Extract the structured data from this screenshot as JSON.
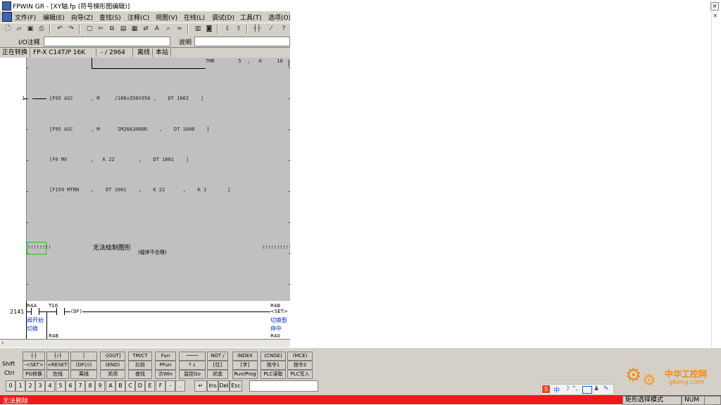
{
  "title_bar": {
    "text": "FPWIN GR - [XY轴.fp (符号梯形图编辑)]"
  },
  "menu": [
    "文件(F)",
    "编辑(E)",
    "向导(Z)",
    "查找(S)",
    "注释(C)",
    "视图(V)",
    "在线(L)",
    "调试(D)",
    "工具(T)",
    "选项(O)"
  ],
  "comment_bar": {
    "io_label": "I/O注释",
    "desc_label": "说明",
    "io_value": "",
    "desc_value": ""
  },
  "status_top": {
    "mode": "正在转换",
    "plc": "FP-X C14T/P 16K",
    "steps": "- / 2964",
    "online": "离线",
    "station": "本站"
  },
  "ladder": {
    "tmr_text": "TMR        5  ,   K     10",
    "row1_num": "1",
    "row1": "[F95 ASC      , M     /180v350V350 ,    DT 1002    ]",
    "row2": "[F95 ASC      , M      IM20A3000R    ,    DT 1008    ]",
    "row3": "[F0 MV        ,   K 22        ,    DT 1001    ]",
    "row4": "[F159 MTRN    ,    DT 1001    ,    K 22      ,    K 1       ]",
    "warn_title": "无法绘制图形",
    "warn_sub": "(程序不合理)",
    "hash_left": "!!!!!!!!",
    "hash_right": "!!!!!!!!!!!",
    "step_no": "2141",
    "c1": "R4A",
    "c1_comment_1": "阀开始",
    "c1_comment_2": "切换",
    "c2": "T16",
    "df": "(DF)",
    "coil": "R4B",
    "coil_set": "<SET>",
    "coil_comment_1": "切换暂",
    "coil_comment_2": "停中",
    "below_left": "R4B",
    "below_right": "R40"
  },
  "fkeys": {
    "shift_label": "Shift",
    "ctrl_label": "Ctrl",
    "row1": [
      "┤├",
      "┤/├",
      "│",
      "-[OUT]",
      "TM/CT",
      "Fun",
      "────",
      "NOT /",
      "INDEX",
      "(CNDE)",
      "(MCE)"
    ],
    "row2": [
      "-<SET>",
      "<RESET>",
      "(DF(/))",
      "(END)",
      "比较",
      "PFun",
      "↑↓",
      "[位]",
      "[字]",
      "指令1",
      "指令2"
    ],
    "row3": [
      "PG转换",
      "在线",
      "离线",
      "关闭",
      "查找",
      "次Win",
      "监控Go",
      "状态",
      "Run/Prog",
      "PLC读取",
      "PLC写入"
    ],
    "numbers": [
      "0",
      "1",
      "2",
      "3",
      "4",
      "5",
      "6",
      "7",
      "8",
      "9",
      "A",
      "B",
      "C",
      "D",
      "E",
      "F",
      "-",
      "."
    ],
    "edit_keys": [
      "↵",
      "Ins",
      "Del",
      "Esc"
    ]
  },
  "ime": {
    "cn": "中",
    "icons": [
      "ime-s-icon",
      "moon-icon",
      "punct-icon",
      "keyboard-icon",
      "skin-icon",
      "tools-icon"
    ]
  },
  "watermark": {
    "name": "中华工控网",
    "url": "gkong.com"
  },
  "statusbar": {
    "message": "无法删除",
    "mode": "矩形选择模式",
    "num": "NUM"
  },
  "colors": {
    "red_status": "#f01818",
    "ladder_grey": "#c0c0c0",
    "comment_blue": "#1030c0",
    "watermark_orange": "#f08a10"
  }
}
